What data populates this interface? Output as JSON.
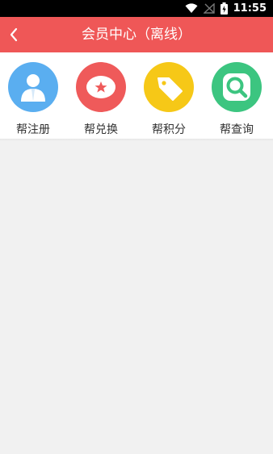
{
  "status_bar": {
    "time": "11:55"
  },
  "header": {
    "title": "会员中心（离线）",
    "back_icon": "chevron-left-icon"
  },
  "shortcuts": [
    {
      "label": "帮注册",
      "icon": "user-icon",
      "color": "#5aaef0"
    },
    {
      "label": "帮兑换",
      "icon": "star-badge-icon",
      "color": "#ef5a5a"
    },
    {
      "label": "帮积分",
      "icon": "tag-icon",
      "color": "#f6c817"
    },
    {
      "label": "帮查询",
      "icon": "search-icon",
      "color": "#3cc580"
    }
  ],
  "colors": {
    "header": "#ef5757",
    "background": "#f1f1f1"
  }
}
